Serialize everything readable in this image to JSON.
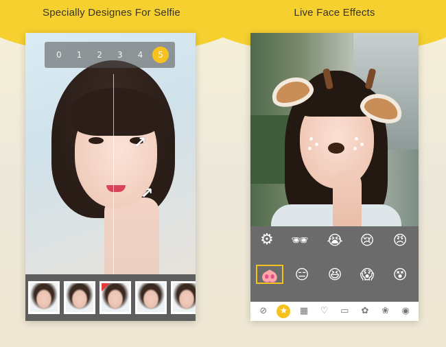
{
  "left": {
    "caption": "Specially Designes For Selfie",
    "levels": [
      "0",
      "1",
      "2",
      "3",
      "4",
      "5"
    ],
    "active_level": 5,
    "thumbnails": 5
  },
  "right": {
    "caption": "Live Face Effects",
    "settings_icon": "gear-icon",
    "effects_row1": [
      "fighting-glasses",
      "crying-eyes",
      "teary-eyes",
      "angry-eyes"
    ],
    "effects_row2": [
      "pig-nose",
      "sleepy-eyes",
      "emoji-faces",
      "shocked-face",
      "dizzy-eyes"
    ],
    "tabs": [
      "⊘",
      "★",
      "▦",
      "♡",
      "▭",
      "✿",
      "❀",
      "◉"
    ],
    "active_tab": 1
  },
  "colors": {
    "accent": "#f7c21e",
    "band": "#f5d02f",
    "panel": "#6b6b6b"
  }
}
